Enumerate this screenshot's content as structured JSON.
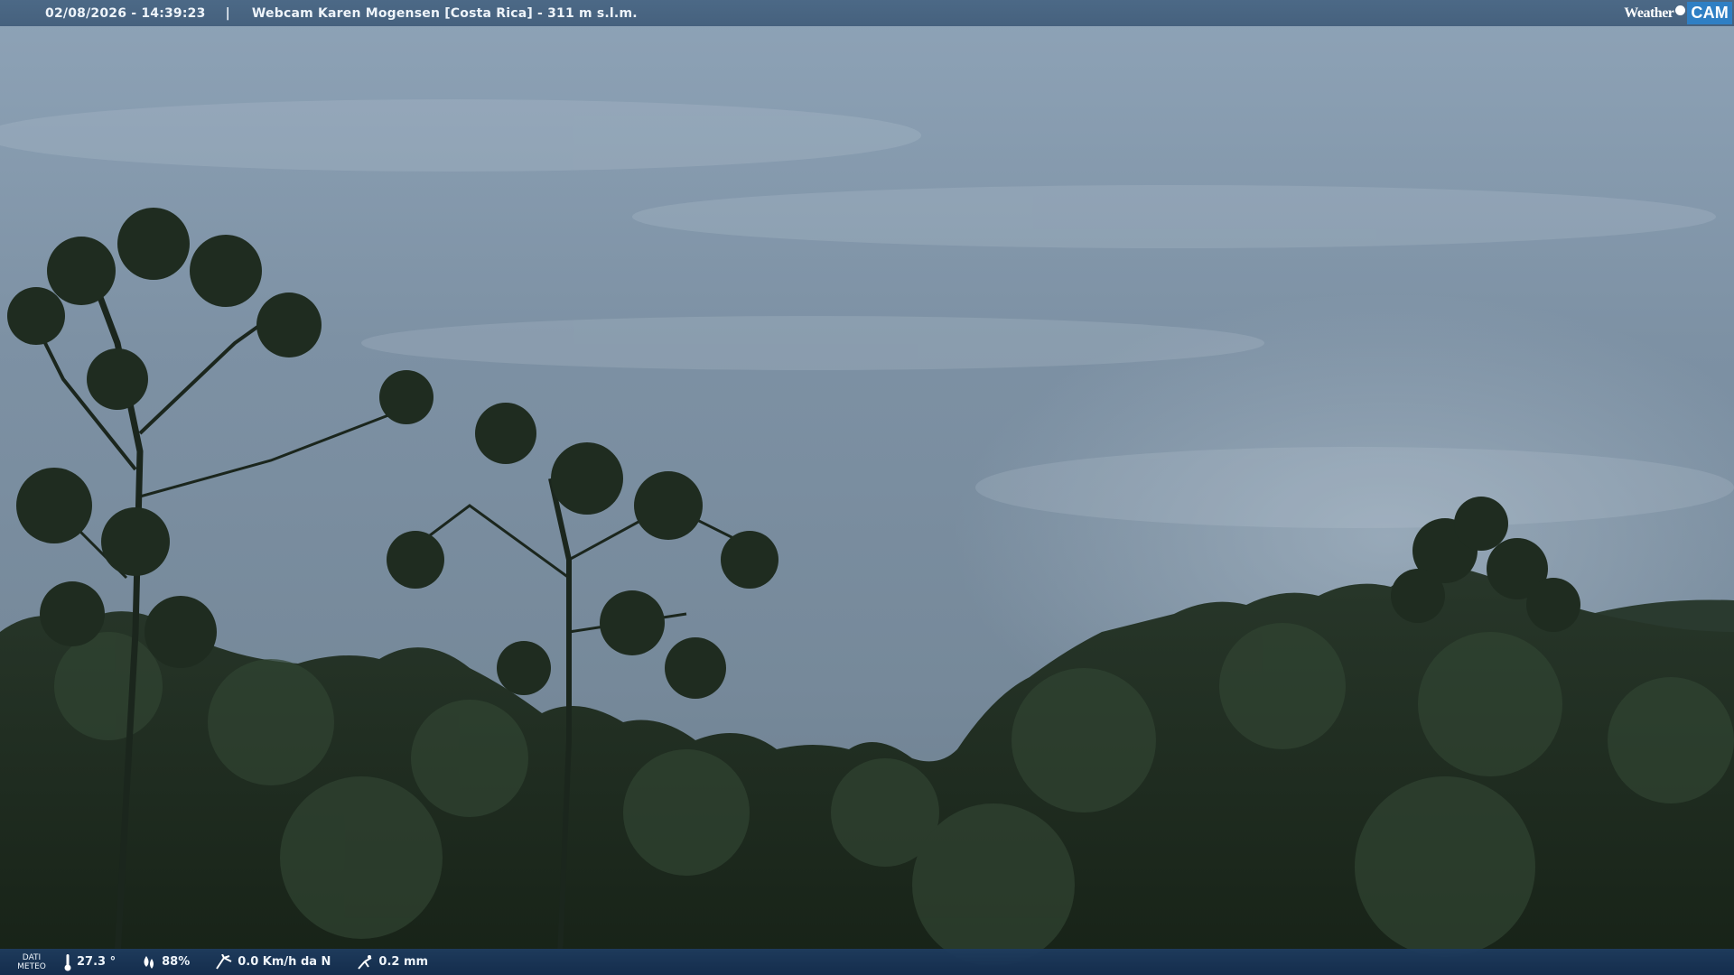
{
  "header": {
    "timestamp": "02/08/2026 - 14:39:23",
    "separator": "|",
    "title": "Webcam Karen Mogensen [Costa Rica]  - 311 m s.l.m."
  },
  "logo": {
    "weather": "Weather",
    "cam": "CAM"
  },
  "footer": {
    "dati_line1": "DATI",
    "dati_line2": "METEO",
    "temperature": "27.3 °",
    "humidity": "88%",
    "wind": "0.0 Km/h da N",
    "rain": "0.2 mm",
    "icons": [
      "thermometer-icon",
      "humidity-icon",
      "wind-icon",
      "rain-gauge-icon"
    ]
  },
  "colors": {
    "sky_top": "#8ea4b8",
    "sky_bottom": "#6f8496",
    "forest_dark": "#1e2a1f",
    "header_bg": "#46647f",
    "footer_bg": "#1c3a5e",
    "logo_accent": "#2f7fc4"
  }
}
